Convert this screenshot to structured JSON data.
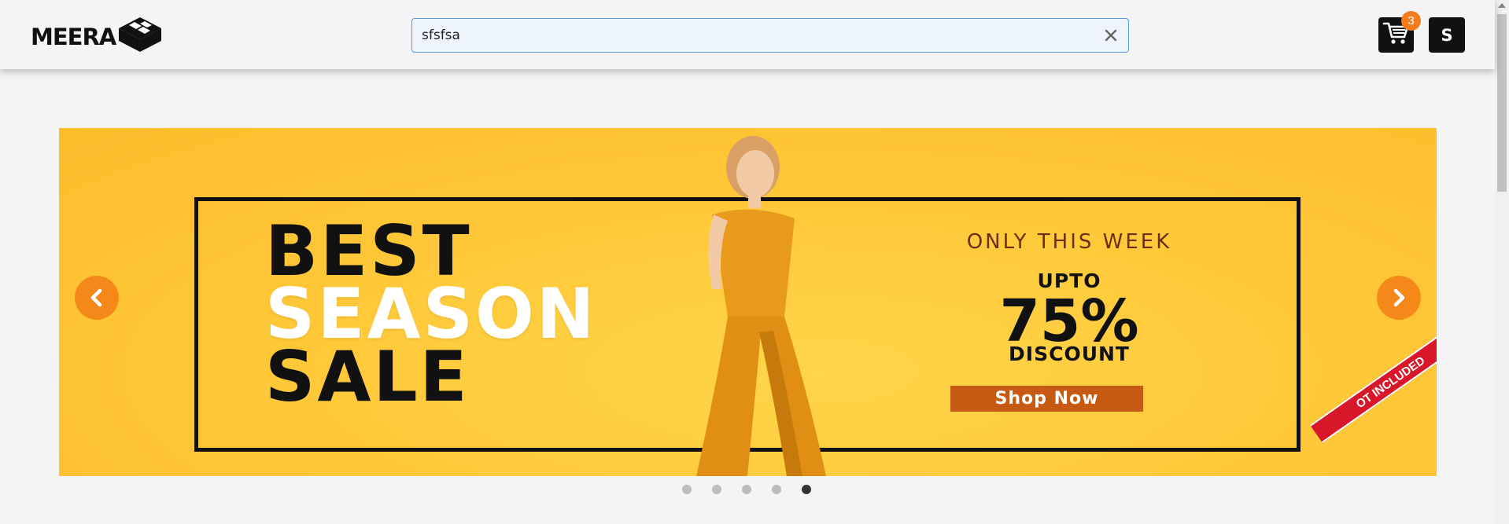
{
  "header": {
    "logo_text": "MEERA",
    "search": {
      "value": "sfsfsa",
      "placeholder": ""
    },
    "cart_count": "3",
    "avatar_letter": "S"
  },
  "banner": {
    "headline": [
      "BEST",
      "SEASON",
      "SALE"
    ],
    "offer_week": "ONLY THIS WEEK",
    "upto": "UPTO",
    "percent": "75%",
    "discount": "DISCOUNT",
    "cta": "Shop Now",
    "ribbon": "OT INCLUDED"
  },
  "carousel": {
    "slide_count": 5,
    "active_index": 4
  },
  "colors": {
    "accent": "#f4891a",
    "banner_bg": "#fbbd2c",
    "badge": "#f47c1c",
    "search_border": "#5a9bdc"
  },
  "icons": [
    "cube-logo-icon",
    "clear-icon",
    "cart-icon",
    "chevron-left-icon",
    "chevron-right-icon"
  ]
}
